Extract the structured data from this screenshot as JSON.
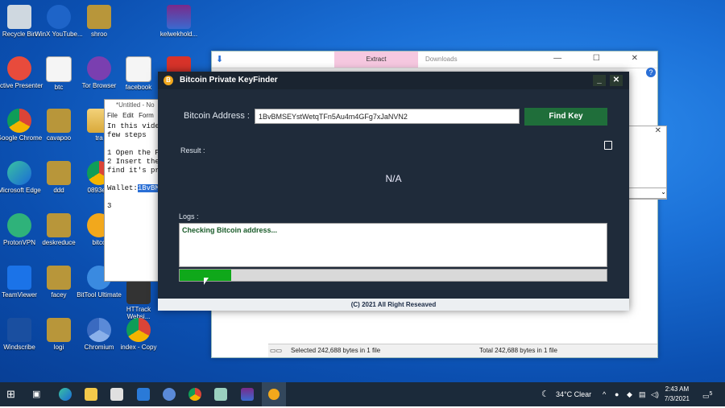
{
  "desktop_icons": [
    {
      "label": "Recycle Bin"
    },
    {
      "label": "WinX YouTube..."
    },
    {
      "label": "shroo"
    },
    {
      "label": "kelwekhold..."
    },
    {
      "label": "Active Presenter"
    },
    {
      "label": "btc"
    },
    {
      "label": "Tor Browser"
    },
    {
      "label": "facebook"
    },
    {
      "label": "Google Chrome"
    },
    {
      "label": "cavapoo"
    },
    {
      "label": "tra"
    },
    {
      "label": "Microsoft Edge"
    },
    {
      "label": "ddd"
    },
    {
      "label": "0893e..."
    },
    {
      "label": "ProtonVPN"
    },
    {
      "label": "deskreduce"
    },
    {
      "label": "bitco"
    },
    {
      "label": "TeamViewer"
    },
    {
      "label": "facey"
    },
    {
      "label": "BitTool Ultimate"
    },
    {
      "label": "HTTrack Websi..."
    },
    {
      "label": "Windscribe"
    },
    {
      "label": "logi"
    },
    {
      "label": "Chromium"
    },
    {
      "label": "index - Copy"
    }
  ],
  "explorer": {
    "tab_extract": "Extract",
    "tab_downloads": "Downloads",
    "window_buttons": "— ☐ ✕",
    "status_selected": "Selected 242,688 bytes in 1 file",
    "status_total": "Total 242,688 bytes in 1 file"
  },
  "notepad": {
    "title": "*Untitled - No",
    "menu": "File Edit Form",
    "line1": "In this video",
    "line2": "few steps",
    "line3": "",
    "line4": "1 Open the P",
    "line5": "2 Insert the",
    "line6": "find it's pr",
    "line7": "",
    "wallet_label": "Wallet:",
    "wallet_sel": "1BvBM",
    "line9": "",
    "line10": "3"
  },
  "app": {
    "title": "Bitcoin Private KeyFinder",
    "min_label": "_",
    "close_label": "✕",
    "address_label": "Bitcoin Address :",
    "address_value": "1BvBMSEYstWetqTFn5Au4m4GFg7xJaNVN2",
    "find_button": "Find Key",
    "result_label": "Result :",
    "result_value": "N/A",
    "logs_label": "Logs :",
    "log_line": "Checking Bitcoin address...",
    "progress_percent": 12,
    "footer": "(C) 2021 All Right Reseaved",
    "accent": "#1f6e3a",
    "progress_color": "#0fa81a"
  },
  "taskbar": {
    "weather": "34°C Clear",
    "time": "2:43 AM",
    "date": "7/3/2021",
    "notification_count": "5"
  }
}
